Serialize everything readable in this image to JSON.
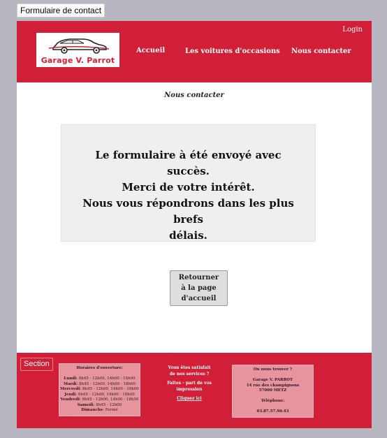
{
  "top_label": "Formulaire de contact",
  "header": {
    "logo_text": "Garage V. Parrot",
    "nav": {
      "accueil": "Accueil",
      "voitures": "Les voitures d'occasions",
      "contact": "Nous contacter",
      "login": "Login"
    },
    "colors": {
      "brand": "#d01f36"
    }
  },
  "main": {
    "subtitle": "Nous contacter",
    "message": {
      "line1": "Le formulaire à été envoyé avec succès.",
      "line2": "Merci de votre intérêt.",
      "line3": "Nous vous répondrons dans les plus brefs",
      "line4": "délais."
    },
    "back_button": {
      "line1": "Retourner",
      "line2": "à la page",
      "line3": "d'accueil"
    }
  },
  "footer": {
    "section_label": "Section",
    "hours": {
      "title": "Horaires d'ouverture:",
      "rows": [
        {
          "day": "Lundi",
          "time": ": 8h45 - 12h00, 14h00 - 18h00"
        },
        {
          "day": "Mardi",
          "time": ": 8h45 - 12h00, 14h00 - 18h00"
        },
        {
          "day": "Mercredi",
          "time": ": 8h45 - 12h00, 14h00 - 18h00"
        },
        {
          "day": "Jeudi",
          "time": ": 8h45 - 12h00, 14h00 - 18h00"
        },
        {
          "day": "Vendredi",
          "time": ": 8h45 - 12h00, 14h00 - 18h00"
        },
        {
          "day": "Samedi",
          "time": ": 8h45 - 12h00"
        },
        {
          "day": "Dimanche",
          "time": ": Fermé"
        }
      ]
    },
    "middle": {
      "line1": "Vous êtes satisfait",
      "line2": "de nos services ?",
      "line3": "Faites - part de vos",
      "line4": "impression",
      "link": "Cliquez ici"
    },
    "address": {
      "title": "Ou nous trouver ?",
      "name": "Garage V. PARROT",
      "street": "14 rue des champignons",
      "city": "57000 METZ",
      "phone_label": "Téléphone:",
      "phone": "03.87.57.90.43"
    }
  }
}
